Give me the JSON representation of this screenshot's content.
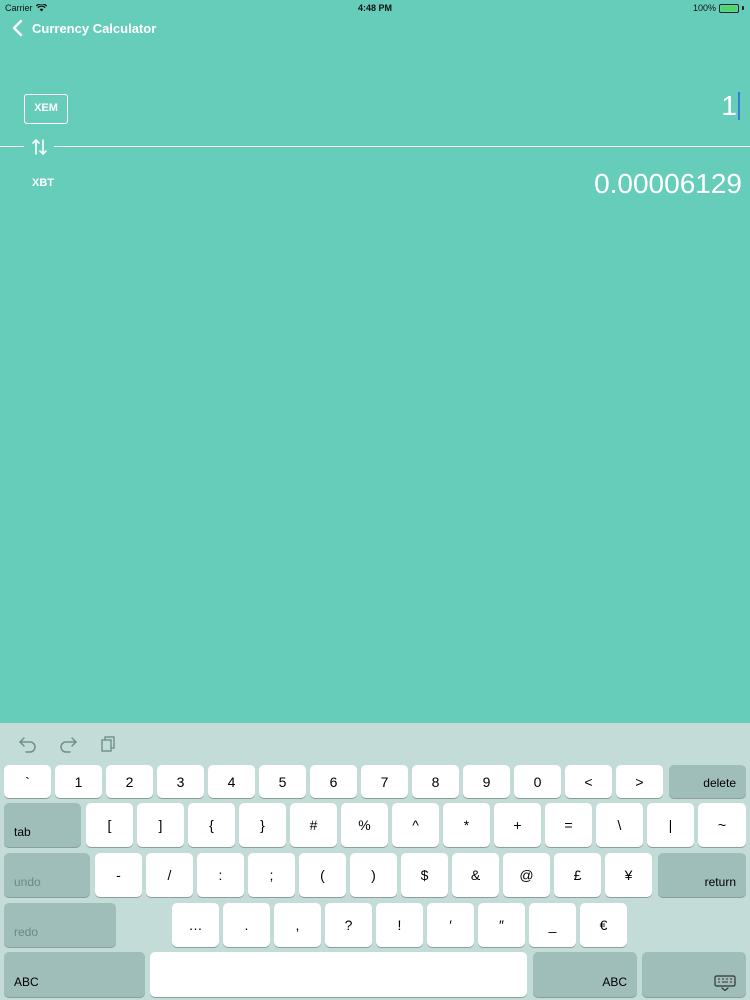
{
  "status_bar": {
    "carrier": "Carrier",
    "time": "4:48 PM",
    "battery": "100%"
  },
  "nav": {
    "back_label": "Currency Calculator"
  },
  "converter": {
    "from_code": "XEM",
    "from_value": "1",
    "to_code": "XBT",
    "to_value": "0.00006129"
  },
  "keyboard": {
    "shortcuts": [
      "undo-icon",
      "redo-icon",
      "paste-icon"
    ],
    "row1": [
      "`",
      "1",
      "2",
      "3",
      "4",
      "5",
      "6",
      "7",
      "8",
      "9",
      "0",
      "<",
      ">"
    ],
    "delete": "delete",
    "tab": "tab",
    "row2": [
      "[",
      "]",
      "{",
      "}",
      "#",
      "%",
      "^",
      "*",
      "+",
      "=",
      "\\",
      "|",
      "~"
    ],
    "undo": "undo",
    "row3": [
      "-",
      "/",
      ":",
      ";",
      "(",
      ")",
      "$",
      "&",
      "@",
      "£",
      "¥"
    ],
    "return": "return",
    "redo": "redo",
    "row4": [
      "…",
      ".",
      ",",
      "?",
      "!",
      "′",
      "″",
      "_",
      "€"
    ],
    "abc_left": "ABC",
    "abc_right": "ABC"
  },
  "colors": {
    "background": "#66cdbb",
    "keyboard": "#c3dcd8",
    "function_key": "#9fbdb9"
  }
}
